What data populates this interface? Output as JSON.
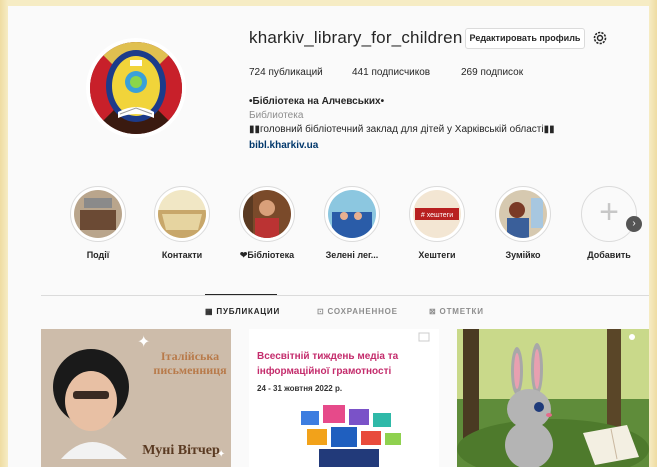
{
  "profile": {
    "username": "kharkiv_library_for_children",
    "edit_button": "Редактировать профиль",
    "posts": "724 публикаций",
    "followers": "441 подписчиков",
    "following": "269 подписок",
    "full_name": "•Бібліотека на Алчевських•",
    "category": "Библиотека",
    "bio": "▮▮головний бібліотечний заклад для дітей у Харківській області▮▮",
    "link": "bibl.kharkiv.ua"
  },
  "highlights": [
    {
      "label": "Події"
    },
    {
      "label": "Контакти"
    },
    {
      "label": "❤Бібліотека"
    },
    {
      "label": "Зелені лег..."
    },
    {
      "label": "Хештеги"
    },
    {
      "label": "Зумійко"
    },
    {
      "label": "Добавить"
    }
  ],
  "tabs": [
    {
      "label": "ПУБЛИКАЦИИ"
    },
    {
      "label": "СОХРАНЕННОЕ"
    },
    {
      "label": "ОТМЕТКИ"
    }
  ],
  "posts": {
    "p1": {
      "title": "Італійська письменниця",
      "name": "Муні Вітчер"
    },
    "p2": {
      "title": "Всесвітній тиждень медіа та інформаційної грамотності",
      "dates": "24 - 31 жовтня 2022 р."
    }
  },
  "highlight_badge": "# хештеги",
  "colors": {
    "accent": "#00376b",
    "post1_bg": "#c9b8a6",
    "post1_text": "#7c4a2f",
    "post2_title": "#c42c6c"
  }
}
